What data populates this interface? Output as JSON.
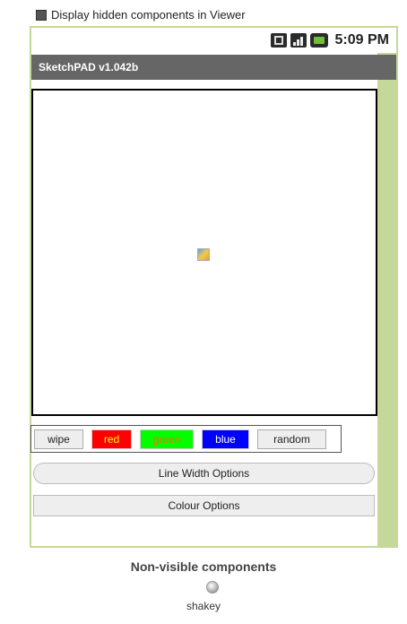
{
  "viewer": {
    "hidden_toggle_label": "Display hidden components in Viewer",
    "hidden_toggle_checked": true
  },
  "statusbar": {
    "time": "5:09 PM",
    "icons": [
      "signal-data-icon",
      "cell-signal-icon",
      "battery-icon"
    ]
  },
  "app": {
    "title": "SketchPAD v1.042b"
  },
  "colors": {
    "phone_frame": "#c5d89a",
    "titlebar": "#666666",
    "red": "#ff0000",
    "green": "#00ff00",
    "blue": "#0000ff"
  },
  "buttons": {
    "wipe": "wipe",
    "red": "red",
    "green": "green",
    "blue": "blue",
    "random": "random",
    "line_width": "Line Width Options",
    "colour_options": "Colour Options"
  },
  "nonvisible": {
    "title": "Non-visible components",
    "items": [
      {
        "label": "shakey",
        "icon": "accelerometer-icon"
      }
    ]
  }
}
